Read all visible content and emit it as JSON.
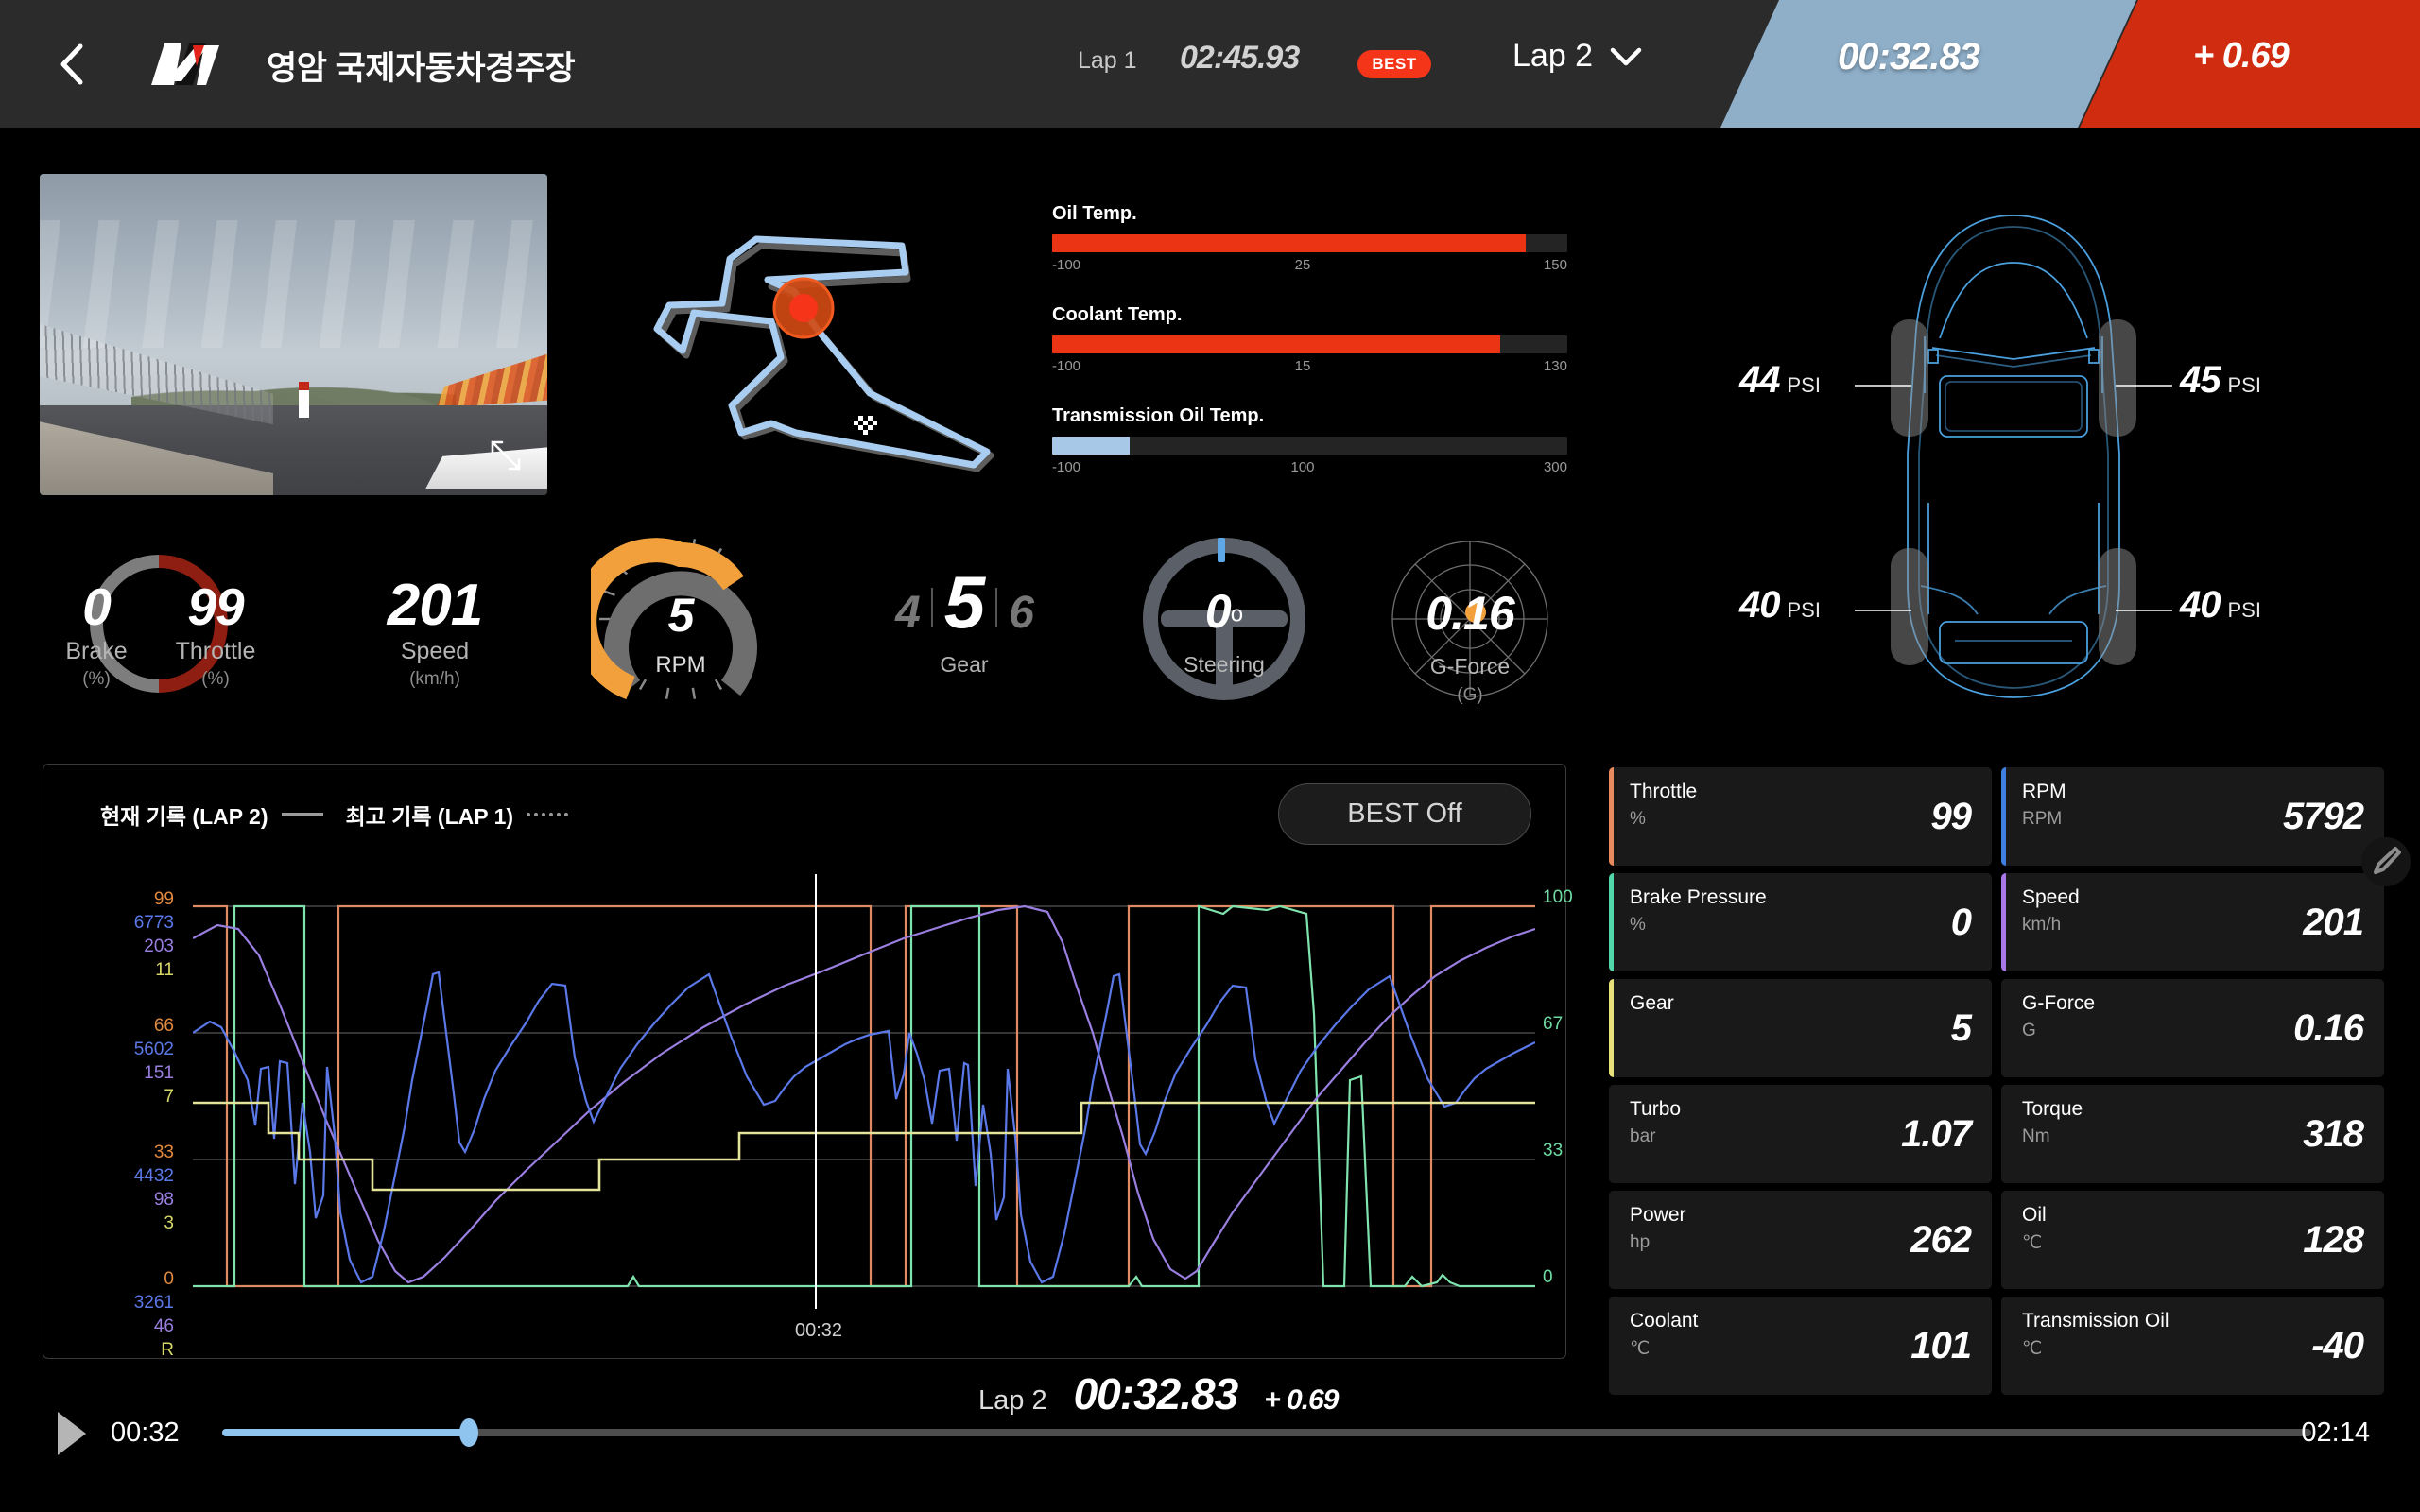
{
  "header": {
    "back_icon": "chevron-left-icon",
    "logo": "hyundai-n-logo",
    "title": "영암 국제자동차경주장",
    "lap1_label": "Lap 1",
    "lap1_time": "02:45.93",
    "best_badge": "BEST",
    "lap_selector": "Lap 2",
    "chevron_icon": "chevron-down-icon",
    "current_lap_time": "00:32.83",
    "delta": "+ 0.69",
    "blue": "#8fafc9",
    "red": "#cf2c10",
    "badge_red": "#f4351a"
  },
  "video": {
    "name": "onboard-camera",
    "expand_icon": "expand-arrows-icon"
  },
  "track_map": {
    "name": "circuit-map",
    "marker": "car-position-marker",
    "start_finish": "checkered-flag-icon"
  },
  "temps": [
    {
      "name": "Oil Temp.",
      "min": "-100",
      "mid": "25",
      "max": "150",
      "percent": 92,
      "color": "#ea3413"
    },
    {
      "name": "Coolant Temp.",
      "min": "-100",
      "mid": "15",
      "max": "130",
      "percent": 87,
      "color": "#ea3413"
    },
    {
      "name": "Transmission Oil Temp.",
      "min": "-100",
      "mid": "100",
      "max": "300",
      "percent": 15,
      "color": "#a8c8e8"
    }
  ],
  "tires": [
    {
      "pos": "front-left",
      "value": "44",
      "unit": "PSI"
    },
    {
      "pos": "front-right",
      "value": "45",
      "unit": "PSI"
    },
    {
      "pos": "rear-left",
      "value": "40",
      "unit": "PSI"
    },
    {
      "pos": "rear-right",
      "value": "40",
      "unit": "PSI"
    }
  ],
  "gauges": {
    "brake": {
      "value": "0",
      "label": "Brake",
      "unit": "(%)",
      "percent": 0
    },
    "throttle": {
      "value": "99",
      "label": "Throttle",
      "unit": "(%)",
      "percent": 99
    },
    "speed": {
      "value": "201",
      "label": "Speed",
      "unit": "(km/h)"
    },
    "rpm": {
      "value": "5",
      "label": "RPM",
      "percent": 58
    },
    "gear": {
      "prev": "4",
      "value": "5",
      "next": "6",
      "label": "Gear"
    },
    "steering": {
      "value": "0",
      "degree": "o",
      "label": "Steering"
    },
    "gforce": {
      "value": "0.16",
      "label": "G-Force",
      "unit": "(G)"
    }
  },
  "chart": {
    "legend_current": "현재 기록 (LAP 2)",
    "legend_best": "최고 기록 (LAP 1)",
    "best_off_button": "BEST Off",
    "cursor_time": "00:32"
  },
  "chart_data": {
    "type": "line",
    "title": "",
    "xlabel": "",
    "ylabel": "",
    "grid": true,
    "legend_position": "top-left",
    "cursor_x_label": "00:32",
    "axes": {
      "left_groups": [
        {
          "series": "Throttle",
          "color": "#e0893f",
          "ticks": [
            "99",
            "66",
            "33",
            "0"
          ]
        },
        {
          "series": "RPM",
          "color": "#5b78e8",
          "ticks": [
            "6773",
            "5602",
            "4432",
            "3261"
          ]
        },
        {
          "series": "Speed",
          "color": "#9a7fe0",
          "ticks": [
            "203",
            "151",
            "98",
            "46"
          ]
        },
        {
          "series": "Gear",
          "color": "#d8d86a",
          "ticks": [
            "11",
            "7",
            "3",
            "R"
          ]
        }
      ],
      "right_group": {
        "series": "Brake Pressure",
        "color": "#6edba3",
        "ticks": [
          "100",
          "67",
          "33",
          "0"
        ]
      }
    },
    "series": [
      {
        "name": "Throttle",
        "color": "#e08a63",
        "unit": "%"
      },
      {
        "name": "RPM",
        "color": "#5b78e8",
        "unit": "RPM"
      },
      {
        "name": "Speed",
        "color": "#9a7fe0",
        "unit": "km/h"
      },
      {
        "name": "Gear",
        "color": "#e3e39a",
        "unit": ""
      },
      {
        "name": "Brake Pressure",
        "color": "#7fe3ad",
        "unit": "%"
      }
    ]
  },
  "lap_summary": {
    "lap": "Lap 2",
    "time": "00:32.83",
    "delta": "+ 0.69"
  },
  "playback": {
    "play_icon": "play-icon",
    "current": "00:32",
    "total": "02:14",
    "progress_percent": 11.8,
    "accent": "#8fc4ee"
  },
  "cards": [
    {
      "name": "Throttle",
      "unit": "%",
      "value": "99",
      "accent": "#e98a5e"
    },
    {
      "name": "RPM",
      "unit": "RPM",
      "value": "5792",
      "accent": "#3f7fe0"
    },
    {
      "name": "Brake Pressure",
      "unit": "%",
      "value": "0",
      "accent": "#52d7ab"
    },
    {
      "name": "Speed",
      "unit": "km/h",
      "value": "201",
      "accent": "#a878e8"
    },
    {
      "name": "Gear",
      "unit": "",
      "value": "5",
      "accent": "#e8e07a"
    },
    {
      "name": "G-Force",
      "unit": "G",
      "value": "0.16",
      "accent": "#191919"
    },
    {
      "name": "Turbo",
      "unit": "bar",
      "value": "1.07",
      "accent": "#191919"
    },
    {
      "name": "Torque",
      "unit": "Nm",
      "value": "318",
      "accent": "#191919"
    },
    {
      "name": "Power",
      "unit": "hp",
      "value": "262",
      "accent": "#191919"
    },
    {
      "name": "Oil",
      "unit": "℃",
      "value": "128",
      "accent": "#191919"
    },
    {
      "name": "Coolant",
      "unit": "℃",
      "value": "101",
      "accent": "#191919"
    },
    {
      "name": "Transmission Oil",
      "unit": "℃",
      "value": "-40",
      "accent": "#191919"
    }
  ],
  "edit_icon": "pencil-edit-icon"
}
